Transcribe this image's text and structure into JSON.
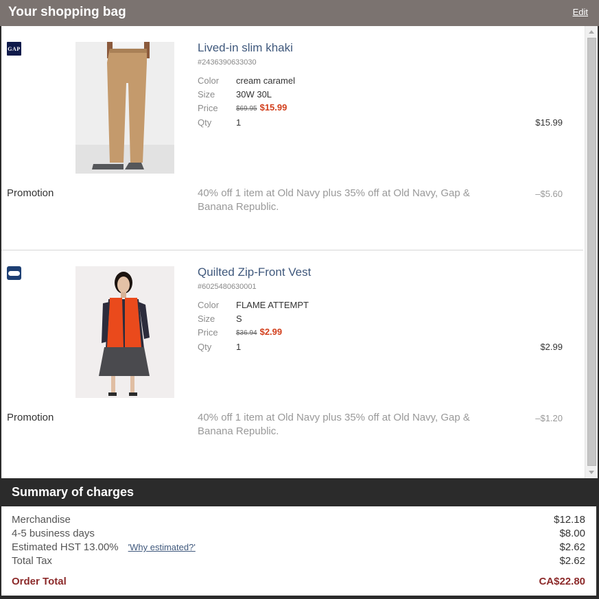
{
  "header": {
    "title": "Your shopping bag",
    "edit_label": "Edit"
  },
  "items": [
    {
      "brand": "GAP",
      "name": "Lived-in slim khaki",
      "sku": "#2436390633030",
      "labels": {
        "color": "Color",
        "size": "Size",
        "price": "Price",
        "qty": "Qty"
      },
      "color": "cream caramel",
      "size": "30W 30L",
      "old_price": "$69.95",
      "sale_price": "$15.99",
      "qty": "1",
      "line_total": "$15.99",
      "promo_label": "Promotion",
      "promo_text": "40% off 1 item at Old Navy plus 35% off at Old Navy, Gap & Banana Republic.",
      "promo_amount": "–$5.60"
    },
    {
      "brand": "OLD NAVY",
      "name": "Quilted Zip-Front Vest",
      "sku": "#6025480630001",
      "labels": {
        "color": "Color",
        "size": "Size",
        "price": "Price",
        "qty": "Qty"
      },
      "color": "FLAME ATTEMPT",
      "size": "S",
      "old_price": "$36.94",
      "sale_price": "$2.99",
      "qty": "1",
      "line_total": "$2.99",
      "promo_label": "Promotion",
      "promo_text": "40% off 1 item at Old Navy plus 35% off at Old Navy, Gap & Banana Republic.",
      "promo_amount": "–$1.20"
    }
  ],
  "summary": {
    "title": "Summary of charges",
    "merchandise_label": "Merchandise",
    "merchandise_value": "$12.18",
    "shipping_label": "4-5 business days",
    "shipping_value": "$8.00",
    "hst_label": "Estimated HST 13.00%",
    "why_label": "'Why estimated?'",
    "hst_value": "$2.62",
    "tax_label": "Total Tax",
    "tax_value": "$2.62",
    "total_label": "Order Total",
    "total_value": "CA$22.80"
  },
  "colors": {
    "header_bg": "#7b7370",
    "accent_sale": "#d23f1c",
    "link": "#3f587c",
    "total": "#8c2a2a"
  }
}
